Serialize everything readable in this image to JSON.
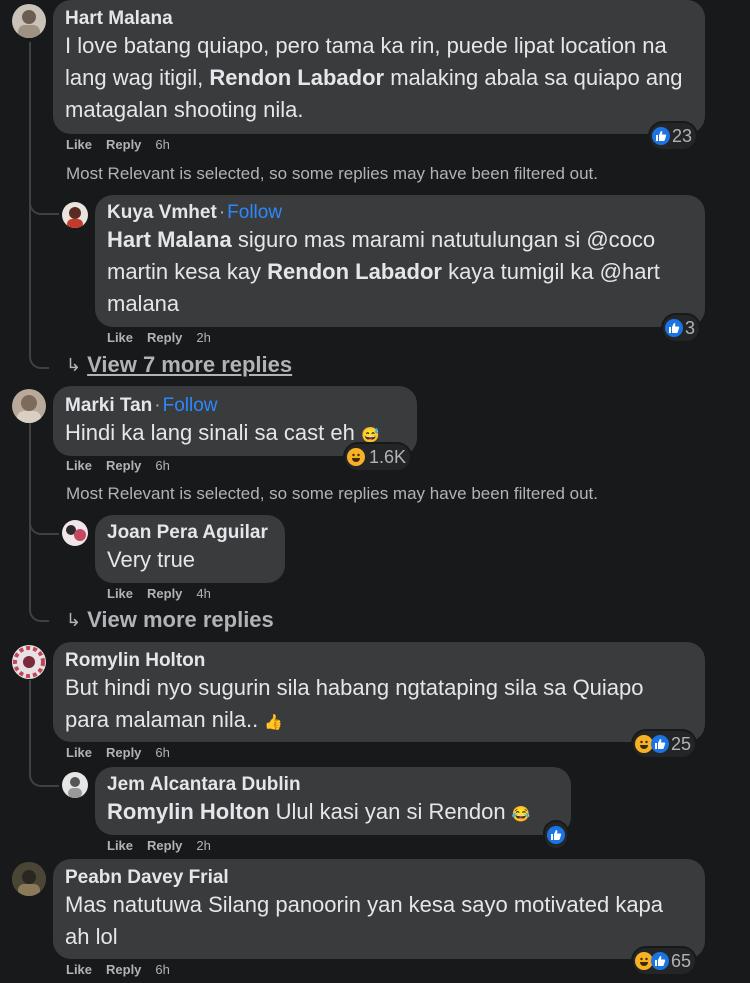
{
  "action_labels": {
    "like": "Like",
    "reply": "Reply"
  },
  "filter_notice": "Most Relevant is selected, so some replies may have been filtered out.",
  "c1": {
    "author": "Hart Malana",
    "t1": "I love batang quiapo, pero tama ka rin, puede lipat location na lang wag itigil, ",
    "mention": "Rendon Labador",
    "t2": " malaking abala sa quiapo ang matagalan shooting nila.",
    "time": "6h",
    "reactions": "23"
  },
  "r1": {
    "author": "Kuya Vmhet",
    "follow": "Follow",
    "mention1": "Hart Malana",
    "t1": " siguro mas marami natutulungan si @coco martin kesa kay ",
    "mention2": "Rendon Labador",
    "t2": " kaya tumigil ka @hart malana",
    "time": "2h",
    "reactions": "3"
  },
  "view_more_1": "View 7 more replies",
  "c2": {
    "author": "Marki Tan",
    "follow": "Follow",
    "text": "Hindi ka lang sinali sa cast eh",
    "time": "6h",
    "reactions": "1.6K"
  },
  "r2": {
    "author": "Joan Pera Aguilar",
    "text": "Very true",
    "time": "4h"
  },
  "view_more_2": "View more replies",
  "c3": {
    "author": "Romylin Holton",
    "text": "But hindi nyo sugurin sila habang ngtataping sila sa Quiapo para malaman nila..",
    "time": "6h",
    "reactions": "25"
  },
  "r3": {
    "author": "Jem Alcantara Dublin",
    "mention": "Romylin Holton",
    "text": " Ulul kasi yan si Rendon",
    "time": "2h"
  },
  "c4": {
    "author": "Peabn Davey Frial",
    "text": "Mas natutuwa Silang panoorin yan kesa sayo motivated kapa ah lol",
    "time": "6h",
    "reactions": "65"
  },
  "colors": {
    "background": "#18191a",
    "bubble": "#3a3b3c",
    "link": "#2d88ff",
    "muted": "#b0b3b8",
    "like": "#1b74e4",
    "haha": "#f7b125"
  }
}
